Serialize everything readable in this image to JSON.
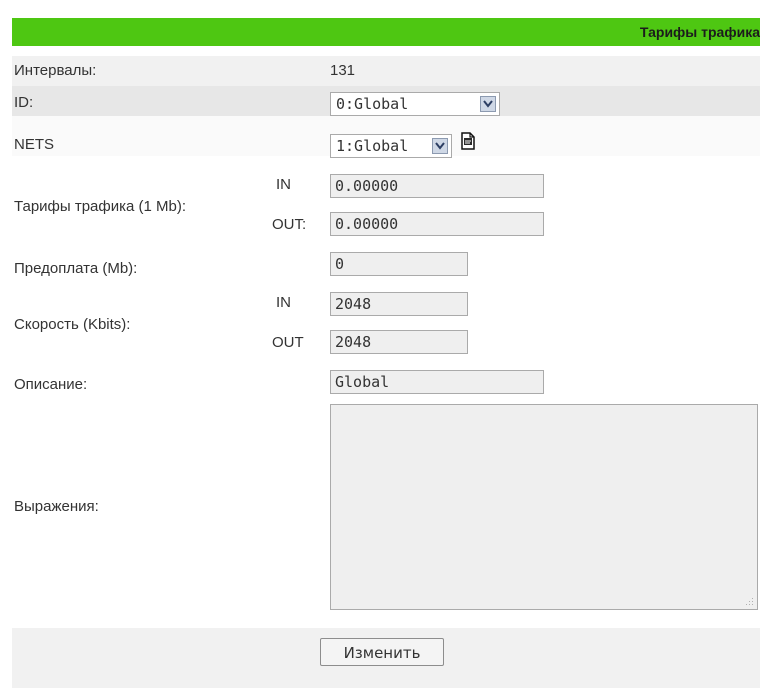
{
  "header": {
    "title": "Тарифы трафика"
  },
  "form": {
    "intervals": {
      "label": "Интервалы:",
      "value": "131"
    },
    "id": {
      "label": "ID:",
      "selected": "0:Global"
    },
    "nets": {
      "label": "NETS",
      "selected": "1:Global"
    },
    "tariffs": {
      "label": "Тарифы трафика (1 Mb):",
      "in_label": "IN",
      "out_label": "OUT:",
      "in_value": "0.00000",
      "out_value": "0.00000"
    },
    "prepay": {
      "label": "Предоплата (Mb):",
      "value": "0"
    },
    "speed": {
      "label": "Скорость (Kbits):",
      "in_label": "IN",
      "out_label": "OUT",
      "in_value": "2048",
      "out_value": "2048"
    },
    "description": {
      "label": "Описание:",
      "value": "Global"
    },
    "expressions": {
      "label": "Выражения:",
      "value": ""
    }
  },
  "footer": {
    "submit_label": "Изменить"
  },
  "icons": {
    "nets_action": "document-icon",
    "resize": "resize-grip-icon",
    "dropdown": "chevron-down-icon"
  },
  "colors": {
    "header": "#4ec712",
    "row_alt": "#f1f1f1",
    "field_bg": "#efefef"
  }
}
